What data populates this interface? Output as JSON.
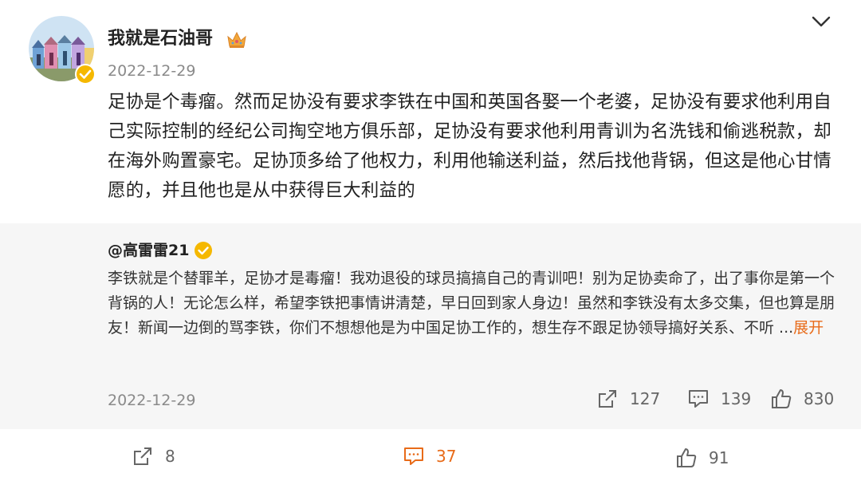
{
  "author": {
    "name": "我就是石油哥",
    "date": "2022-12-29",
    "avatar": "beach-huts-avatar",
    "badge": "verified-icon",
    "decoration": "crown-icon"
  },
  "post": {
    "text": "足协是个毒瘤。然而足协没有要求李铁在中国和英国各娶一个老婆，足协没有要求他利用自己实际控制的经纪公司掏空地方俱乐部，足协没有要求他利用青训为名洗钱和偷逃税款，却在海外购置豪宅。足协顶多给了他权力，利用他输送利益，然后找他背锅，但这是他心甘情愿的，并且他也是从中获得巨大利益的"
  },
  "quoted": {
    "author": "@高雷雷21",
    "text": "李铁就是个替罪羊，足协才是毒瘤！我劝退役的球员搞搞自己的青训吧！别为足协卖命了，出了事你是第一个背锅的人！无论怎么样，希望李铁把事情讲清楚，早日回到家人身边！虽然和李铁没有太多交集，但也算是朋友！新闻一边倒的骂李铁，你们不想想他是为中国足协工作的，想生存不跟足协领导搞好关系、不听 ...",
    "expand_label": "展开",
    "date": "2022-12-29",
    "reposts": "127",
    "comments": "139",
    "likes": "830"
  },
  "footer": {
    "reposts": "8",
    "comments": "37",
    "likes": "91"
  },
  "colors": {
    "accent": "#e86b19",
    "quote_bg": "#f6f6f6",
    "verified": "#f5b800"
  }
}
